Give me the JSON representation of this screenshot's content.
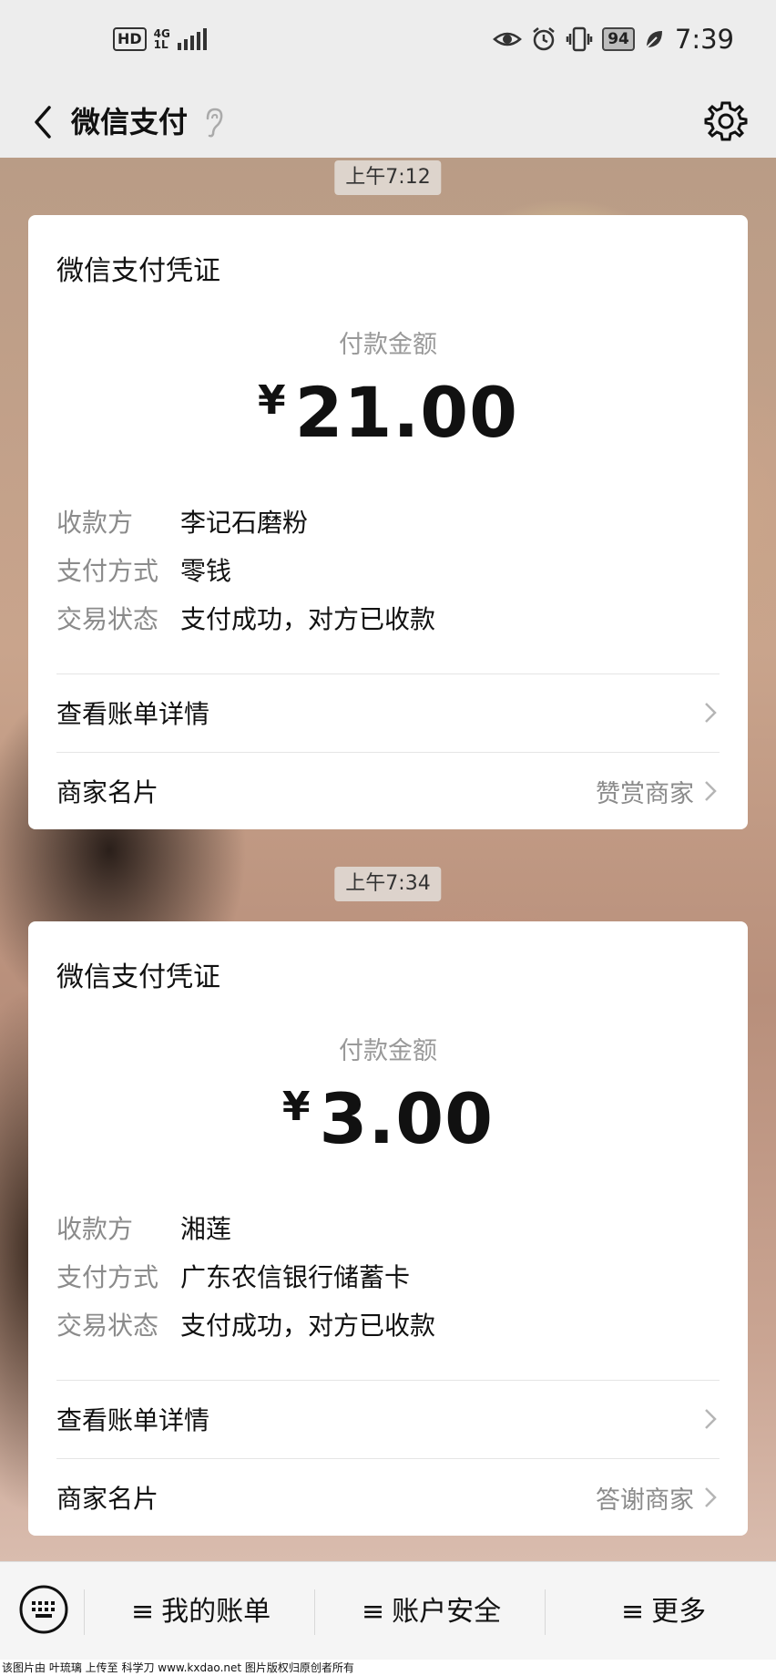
{
  "status_bar": {
    "hd": "HD",
    "network_top": "4G",
    "network_bottom": "1L",
    "battery": "94",
    "time": "7:39"
  },
  "nav": {
    "title": "微信支付",
    "back_icon": "chevron-left-icon",
    "ear_icon": "ear-icon",
    "settings_icon": "gear-icon"
  },
  "messages": [
    {
      "timestamp": "上午7:12",
      "card_title": "微信支付凭证",
      "amount_label": "付款金额",
      "currency": "¥",
      "amount": "21.00",
      "rows": [
        {
          "key": "收款方",
          "value": "李记石磨粉"
        },
        {
          "key": "支付方式",
          "value": "零钱"
        },
        {
          "key": "交易状态",
          "value": "支付成功，对方已收款"
        }
      ],
      "bill_detail": "查看账单详情",
      "merchant_card": "商家名片",
      "merchant_action": "赞赏商家"
    },
    {
      "timestamp": "上午7:34",
      "card_title": "微信支付凭证",
      "amount_label": "付款金额",
      "currency": "¥",
      "amount": "3.00",
      "rows": [
        {
          "key": "收款方",
          "value": "湘莲"
        },
        {
          "key": "支付方式",
          "value": "广东农信银行储蓄卡"
        },
        {
          "key": "交易状态",
          "value": "支付成功，对方已收款"
        }
      ],
      "bill_detail": "查看账单详情",
      "merchant_card": "商家名片",
      "merchant_action": "答谢商家"
    }
  ],
  "bottom_bar": {
    "menu_symbol": "≡",
    "items": [
      "我的账单",
      "账户安全",
      "更多"
    ]
  },
  "watermark": "该图片由 叶琉璃 上传至 科学刀 www.kxdao.net 图片版权归原创者所有"
}
